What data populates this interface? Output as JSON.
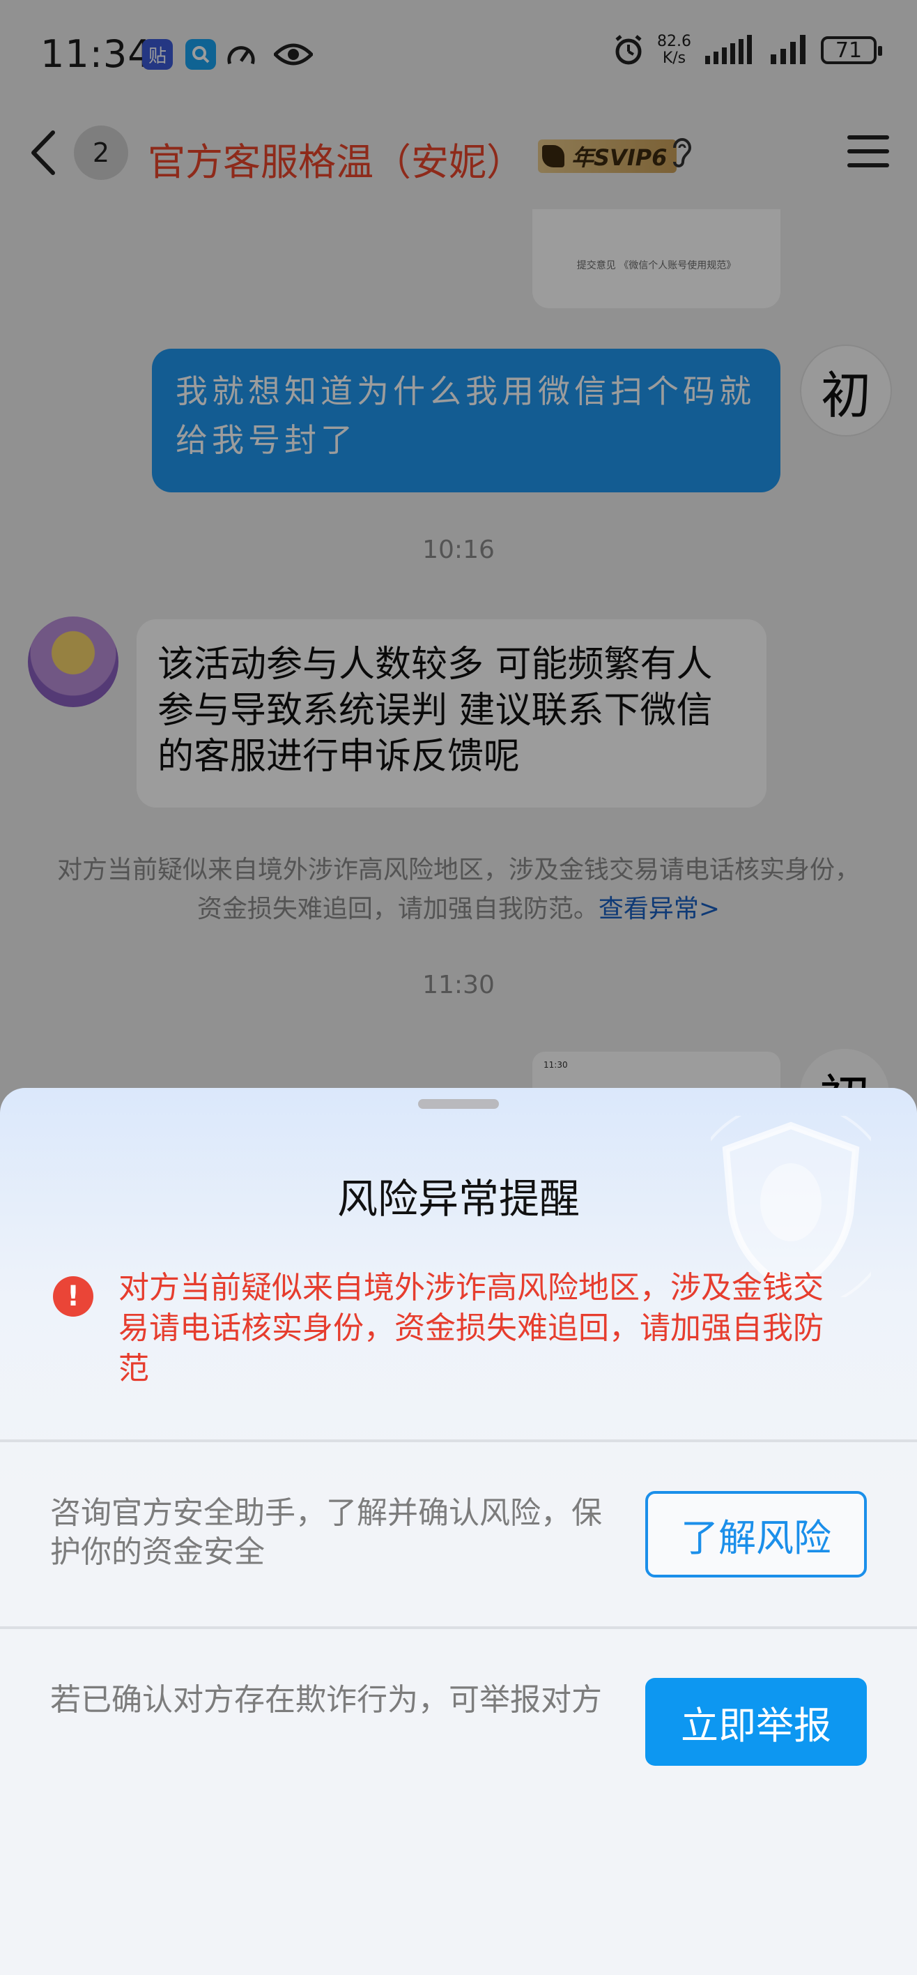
{
  "status_bar": {
    "time": "11:34",
    "app_icon_1": "贴",
    "net_speed_value": "82.6",
    "net_speed_unit": "K/s",
    "battery": "71",
    "icons": [
      "tieba-icon",
      "search-app-icon",
      "speed-icon",
      "eye-icon",
      "alarm-icon",
      "signal-icon",
      "signal-icon-2",
      "battery-icon"
    ]
  },
  "header": {
    "unread_count": "2",
    "title": "官方客服格温（安妮）",
    "badge": "年SVIP6"
  },
  "chat": {
    "image_card_caption": "提交意见 《微信个人账号使用规范》",
    "outgoing_message": "我就想知道为什么我用微信扫个码就给我号封了",
    "outgoing_avatar_char": "初",
    "timestamp_1": "10:16",
    "incoming_message": "该活动参与人数较多 可能频繁有人参与导致系统误判 建议联系下微信的客服进行申诉反馈呢",
    "system_notice": "对方当前疑似来自境外涉诈高风险地区，涉及金钱交易请电话核实身份，资金损失难追回，请加强自我防范。",
    "system_notice_link": "查看异常>",
    "timestamp_2": "11:30",
    "thumb_time": "11:30"
  },
  "sheet": {
    "title": "风险异常提醒",
    "warning": "对方当前疑似来自境外涉诈高风险地区，涉及金钱交易请电话核实身份，资金损失难追回，请加强自我防范",
    "consult_text": "咨询官方安全助手，了解并确认风险，保护你的资金安全",
    "consult_button": "了解风险",
    "report_text": "若已确认对方存在欺诈行为，可举报对方",
    "report_button": "立即举报",
    "colors": {
      "warning_red": "#e63d2e",
      "accent_blue": "#0d97f1"
    }
  }
}
